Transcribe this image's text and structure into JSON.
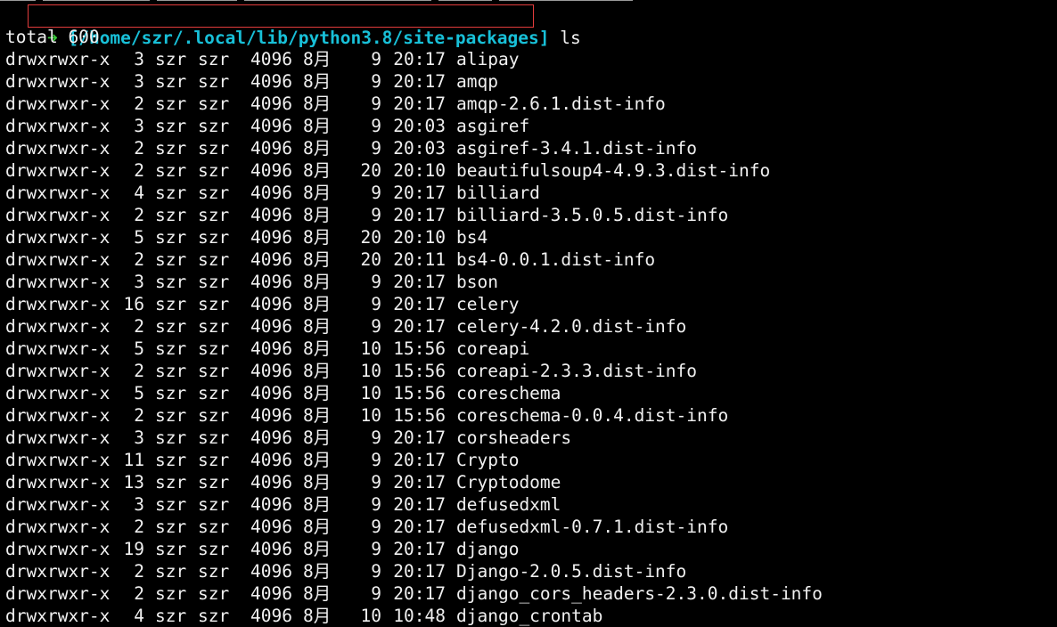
{
  "colors": {
    "background": "#000000",
    "text": "#f0f0f0",
    "prompt_arrow": "#39c93a",
    "prompt_path": "#18c0d8",
    "highlight_border": "#e23c3c"
  },
  "prompt": {
    "arrow": "➜",
    "path": "[/home/szr/.local/lib/python3.8/site-packages]",
    "command": "ls"
  },
  "total_line": "total 600",
  "entries": [
    {
      "perms": "drwxrwxr-x",
      "links": "3",
      "owner": "szr",
      "group": "szr",
      "size": "4096",
      "month": "8月",
      "day": "9",
      "time": "20:17",
      "name": "alipay"
    },
    {
      "perms": "drwxrwxr-x",
      "links": "3",
      "owner": "szr",
      "group": "szr",
      "size": "4096",
      "month": "8月",
      "day": "9",
      "time": "20:17",
      "name": "amqp"
    },
    {
      "perms": "drwxrwxr-x",
      "links": "2",
      "owner": "szr",
      "group": "szr",
      "size": "4096",
      "month": "8月",
      "day": "9",
      "time": "20:17",
      "name": "amqp-2.6.1.dist-info"
    },
    {
      "perms": "drwxrwxr-x",
      "links": "3",
      "owner": "szr",
      "group": "szr",
      "size": "4096",
      "month": "8月",
      "day": "9",
      "time": "20:03",
      "name": "asgiref"
    },
    {
      "perms": "drwxrwxr-x",
      "links": "2",
      "owner": "szr",
      "group": "szr",
      "size": "4096",
      "month": "8月",
      "day": "9",
      "time": "20:03",
      "name": "asgiref-3.4.1.dist-info"
    },
    {
      "perms": "drwxrwxr-x",
      "links": "2",
      "owner": "szr",
      "group": "szr",
      "size": "4096",
      "month": "8月",
      "day": "20",
      "time": "20:10",
      "name": "beautifulsoup4-4.9.3.dist-info"
    },
    {
      "perms": "drwxrwxr-x",
      "links": "4",
      "owner": "szr",
      "group": "szr",
      "size": "4096",
      "month": "8月",
      "day": "9",
      "time": "20:17",
      "name": "billiard"
    },
    {
      "perms": "drwxrwxr-x",
      "links": "2",
      "owner": "szr",
      "group": "szr",
      "size": "4096",
      "month": "8月",
      "day": "9",
      "time": "20:17",
      "name": "billiard-3.5.0.5.dist-info"
    },
    {
      "perms": "drwxrwxr-x",
      "links": "5",
      "owner": "szr",
      "group": "szr",
      "size": "4096",
      "month": "8月",
      "day": "20",
      "time": "20:10",
      "name": "bs4"
    },
    {
      "perms": "drwxrwxr-x",
      "links": "2",
      "owner": "szr",
      "group": "szr",
      "size": "4096",
      "month": "8月",
      "day": "20",
      "time": "20:11",
      "name": "bs4-0.0.1.dist-info"
    },
    {
      "perms": "drwxrwxr-x",
      "links": "3",
      "owner": "szr",
      "group": "szr",
      "size": "4096",
      "month": "8月",
      "day": "9",
      "time": "20:17",
      "name": "bson"
    },
    {
      "perms": "drwxrwxr-x",
      "links": "16",
      "owner": "szr",
      "group": "szr",
      "size": "4096",
      "month": "8月",
      "day": "9",
      "time": "20:17",
      "name": "celery"
    },
    {
      "perms": "drwxrwxr-x",
      "links": "2",
      "owner": "szr",
      "group": "szr",
      "size": "4096",
      "month": "8月",
      "day": "9",
      "time": "20:17",
      "name": "celery-4.2.0.dist-info"
    },
    {
      "perms": "drwxrwxr-x",
      "links": "5",
      "owner": "szr",
      "group": "szr",
      "size": "4096",
      "month": "8月",
      "day": "10",
      "time": "15:56",
      "name": "coreapi"
    },
    {
      "perms": "drwxrwxr-x",
      "links": "2",
      "owner": "szr",
      "group": "szr",
      "size": "4096",
      "month": "8月",
      "day": "10",
      "time": "15:56",
      "name": "coreapi-2.3.3.dist-info"
    },
    {
      "perms": "drwxrwxr-x",
      "links": "5",
      "owner": "szr",
      "group": "szr",
      "size": "4096",
      "month": "8月",
      "day": "10",
      "time": "15:56",
      "name": "coreschema"
    },
    {
      "perms": "drwxrwxr-x",
      "links": "2",
      "owner": "szr",
      "group": "szr",
      "size": "4096",
      "month": "8月",
      "day": "10",
      "time": "15:56",
      "name": "coreschema-0.0.4.dist-info"
    },
    {
      "perms": "drwxrwxr-x",
      "links": "3",
      "owner": "szr",
      "group": "szr",
      "size": "4096",
      "month": "8月",
      "day": "9",
      "time": "20:17",
      "name": "corsheaders"
    },
    {
      "perms": "drwxrwxr-x",
      "links": "11",
      "owner": "szr",
      "group": "szr",
      "size": "4096",
      "month": "8月",
      "day": "9",
      "time": "20:17",
      "name": "Crypto"
    },
    {
      "perms": "drwxrwxr-x",
      "links": "13",
      "owner": "szr",
      "group": "szr",
      "size": "4096",
      "month": "8月",
      "day": "9",
      "time": "20:17",
      "name": "Cryptodome"
    },
    {
      "perms": "drwxrwxr-x",
      "links": "3",
      "owner": "szr",
      "group": "szr",
      "size": "4096",
      "month": "8月",
      "day": "9",
      "time": "20:17",
      "name": "defusedxml"
    },
    {
      "perms": "drwxrwxr-x",
      "links": "2",
      "owner": "szr",
      "group": "szr",
      "size": "4096",
      "month": "8月",
      "day": "9",
      "time": "20:17",
      "name": "defusedxml-0.7.1.dist-info"
    },
    {
      "perms": "drwxrwxr-x",
      "links": "19",
      "owner": "szr",
      "group": "szr",
      "size": "4096",
      "month": "8月",
      "day": "9",
      "time": "20:17",
      "name": "django"
    },
    {
      "perms": "drwxrwxr-x",
      "links": "2",
      "owner": "szr",
      "group": "szr",
      "size": "4096",
      "month": "8月",
      "day": "9",
      "time": "20:17",
      "name": "Django-2.0.5.dist-info"
    },
    {
      "perms": "drwxrwxr-x",
      "links": "2",
      "owner": "szr",
      "group": "szr",
      "size": "4096",
      "month": "8月",
      "day": "9",
      "time": "20:17",
      "name": "django_cors_headers-2.3.0.dist-info"
    },
    {
      "perms": "drwxrwxr-x",
      "links": "4",
      "owner": "szr",
      "group": "szr",
      "size": "4096",
      "month": "8月",
      "day": "10",
      "time": "10:48",
      "name": "django_crontab"
    }
  ]
}
